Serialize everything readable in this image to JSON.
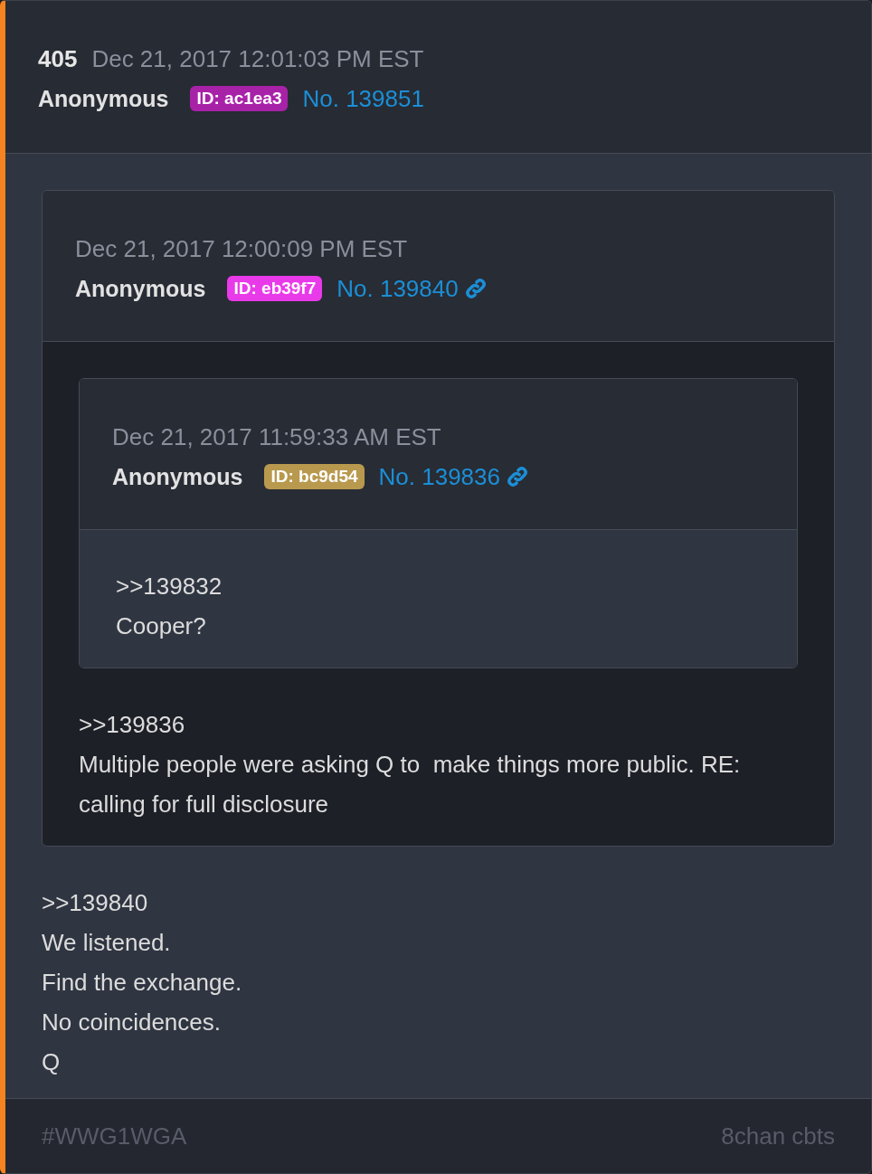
{
  "post": {
    "number": "405",
    "timestamp": "Dec 21, 2017 12:01:03 PM EST",
    "author": "Anonymous",
    "id_badge": {
      "text": "ID: ac1ea3",
      "color": "#a822a8"
    },
    "post_no": "No. 139851",
    "linked": false,
    "quote": {
      "timestamp": "Dec 21, 2017 12:00:09 PM EST",
      "author": "Anonymous",
      "id_badge": {
        "text": "ID: eb39f7",
        "color": "#e93ae9"
      },
      "post_no": "No. 139840",
      "linked": true,
      "quote": {
        "timestamp": "Dec 21, 2017 11:59:33 AM EST",
        "author": "Anonymous",
        "id_badge": {
          "text": "ID: bc9d54",
          "color": "#b8994e"
        },
        "post_no": "No. 139836",
        "linked": true,
        "lines": [
          ">>139832",
          "Cooper?"
        ]
      },
      "lines": [
        ">>139836",
        "Multiple people were asking Q to  make things more public. RE: calling for full disclosure"
      ]
    },
    "lines": [
      ">>139840",
      "We listened.",
      "Find the exchange.",
      "No coincidences.",
      "Q"
    ]
  },
  "footer": {
    "tag": "#WWG1WGA",
    "source": "8chan cbts"
  }
}
